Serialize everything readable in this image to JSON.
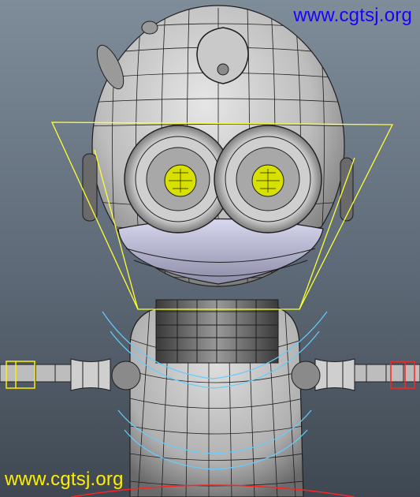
{
  "viewport": {
    "background_top": "#7f8c99",
    "background_bottom": "#3f4852"
  },
  "watermarks": {
    "top": {
      "text": "www.cgtsj.org",
      "color": "#1a00ff"
    },
    "bottom": {
      "text": "www.cgtsj.org",
      "color": "#ffee00"
    }
  },
  "colors": {
    "mesh_fill": "#bfbfbf",
    "mesh_wire": "#1e1e1e",
    "face_rig_curve": "#ffff33",
    "collar_curves": "#66ccff",
    "arm_control_right": "#ff2222",
    "arm_control_left": "#ffee00",
    "eye_pupil": "#d8e000"
  },
  "icons": {
    "model": "robot-head-wireframe-icon"
  }
}
